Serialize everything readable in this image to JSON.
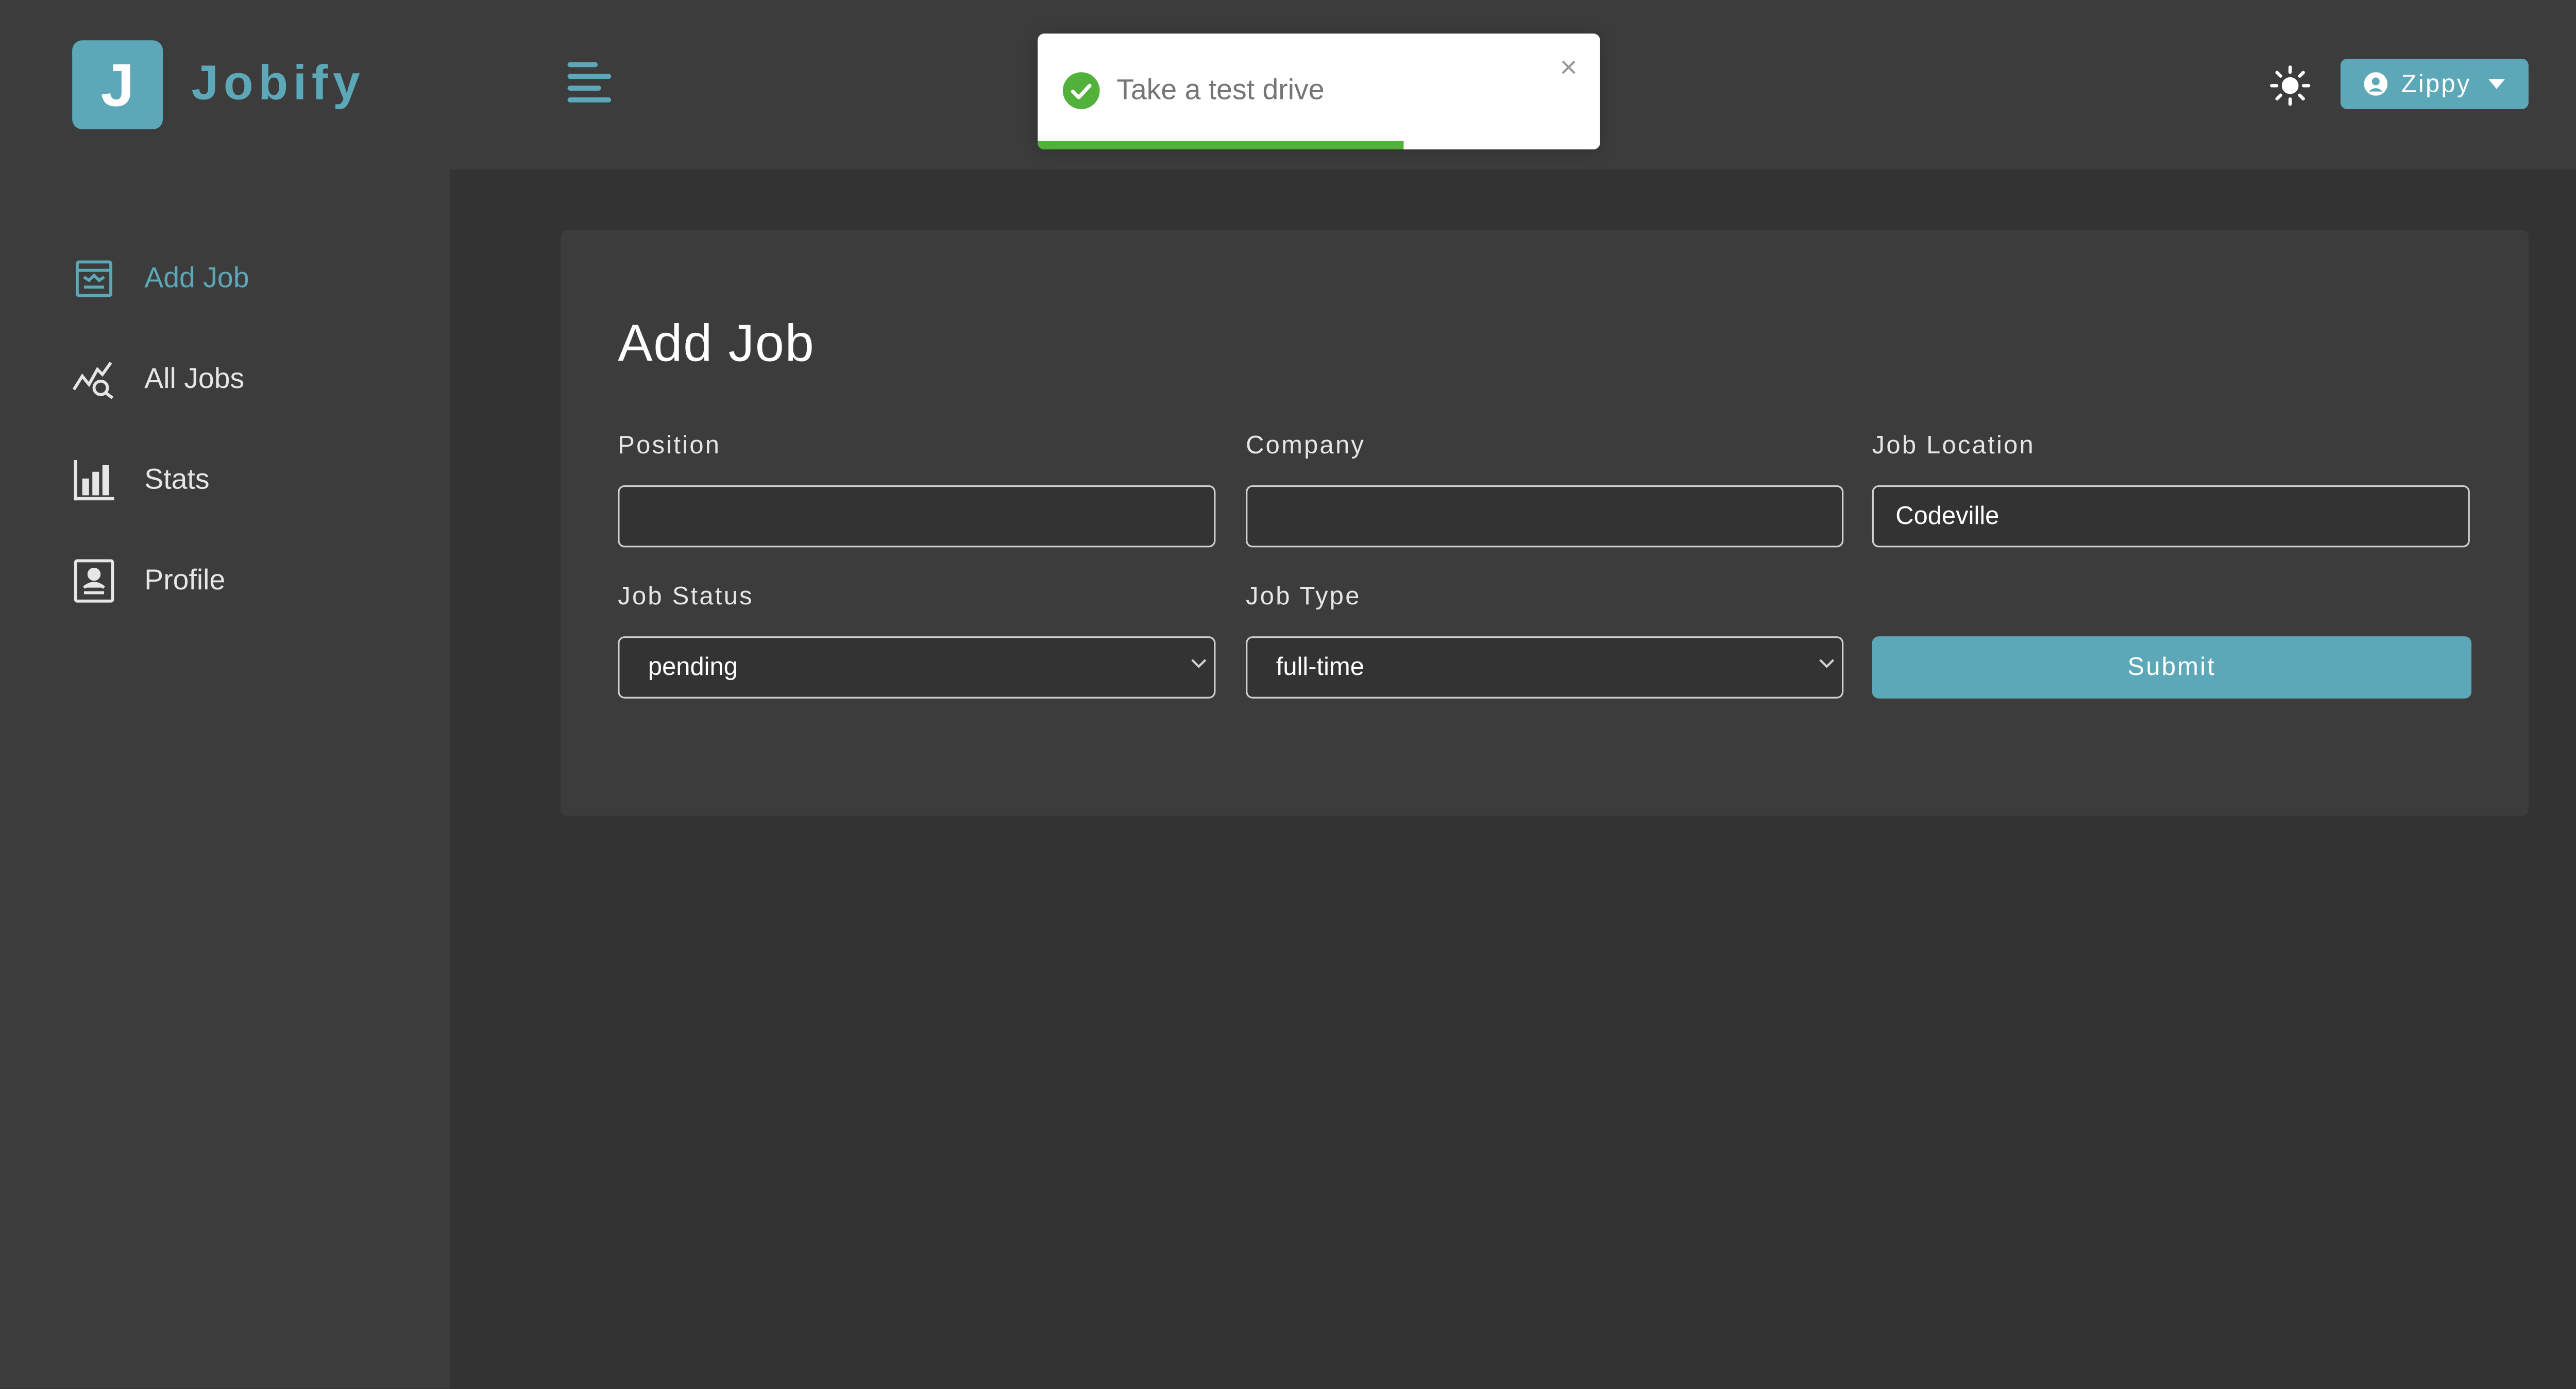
{
  "app": {
    "logo_letter": "J",
    "logo_text": "Jobify",
    "accent_color": "#5ca8b8"
  },
  "sidebar": {
    "items": [
      {
        "label": "Add Job",
        "icon": "add-job-icon",
        "active": true
      },
      {
        "label": "All Jobs",
        "icon": "all-jobs-icon",
        "active": false
      },
      {
        "label": "Stats",
        "icon": "stats-icon",
        "active": false
      },
      {
        "label": "Profile",
        "icon": "profile-icon",
        "active": false
      }
    ]
  },
  "header": {
    "user_name": "Zippy",
    "theme_icon": "sun-icon",
    "menu_icon": "hamburger-icon"
  },
  "toast": {
    "message": "Take a test drive",
    "close": "×",
    "status": "success",
    "progress": 0.65
  },
  "form": {
    "title": "Add Job",
    "position": {
      "label": "Position",
      "value": ""
    },
    "company": {
      "label": "Company",
      "value": ""
    },
    "job_location": {
      "label": "Job Location",
      "value": "Codeville"
    },
    "job_status": {
      "label": "Job Status",
      "value": "pending"
    },
    "job_type": {
      "label": "Job Type",
      "value": "full-time"
    },
    "submit_label": "Submit"
  }
}
